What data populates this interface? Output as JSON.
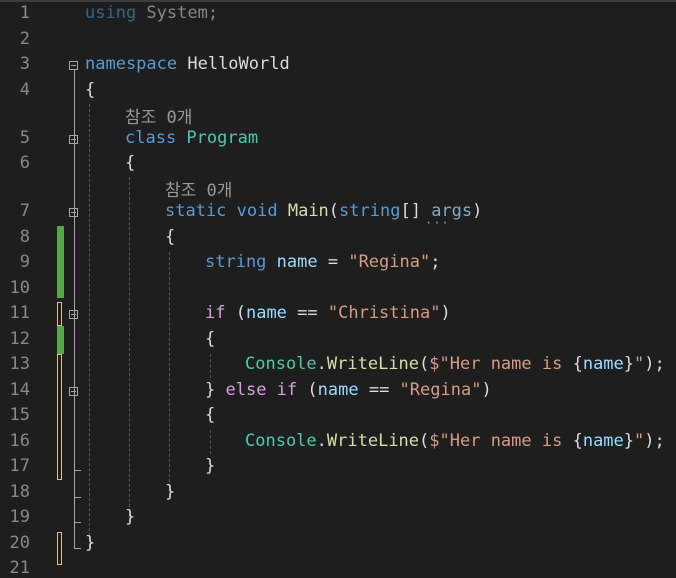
{
  "editor": {
    "line_numbers": [
      "1",
      "2",
      "3",
      "4",
      "5",
      "6",
      "7",
      "8",
      "9",
      "10",
      "11",
      "12",
      "13",
      "14",
      "15",
      "16",
      "17",
      "18",
      "19",
      "20",
      "21"
    ],
    "lines": {
      "l1_kw": "using",
      "l1_rest": " System;",
      "l3_kw": "namespace",
      "l3_name": " HelloWorld",
      "l4": "{",
      "lens_program": "참조 0개",
      "l5_kw": "class",
      "l5_name": " Program",
      "l6": "{",
      "lens_main": "참조 0개",
      "l7_kw1": "static",
      "l7_kw2": " void",
      "l7_fn": " Main",
      "l7_p1": "(",
      "l7_kw3": "string",
      "l7_p2": "[] ",
      "l7_param": "args",
      "l7_p3": ")",
      "l8": "{",
      "l9_kw": "string",
      "l9_var": " name",
      "l9_op": " = ",
      "l9_str": "\"Regina\"",
      "l9_end": ";",
      "l11_ctl": "if",
      "l11_p1": " (",
      "l11_var": "name",
      "l11_op": " == ",
      "l11_str": "\"Christina\"",
      "l11_p2": ")",
      "l12": "{",
      "l13_ty": "Console",
      "l13_dot": ".",
      "l13_fn": "WriteLine",
      "l13_p1": "(",
      "l13_str1": "$\"Her name is ",
      "l13_b1": "{",
      "l13_var": "name",
      "l13_b2": "}",
      "l13_str2": "\"",
      "l13_end": ");",
      "l14_b": "} ",
      "l14_ctl1": "else",
      "l14_ctl2": " if",
      "l14_p1": " (",
      "l14_var": "name",
      "l14_op": " == ",
      "l14_str": "\"Regina\"",
      "l14_p2": ")",
      "l15": "{",
      "l16_ty": "Console",
      "l16_dot": ".",
      "l16_fn": "WriteLine",
      "l16_p1": "(",
      "l16_str1": "$\"Her name is ",
      "l16_b1": "{",
      "l16_var": "name",
      "l16_b2": "}",
      "l16_str2": "\"",
      "l16_end": ");",
      "l17": "}",
      "l18": "}",
      "l19": "}",
      "l20": "}"
    }
  },
  "colors": {
    "background": "#1e1e1e",
    "keyword": "#569cd6",
    "type": "#4ec9b0",
    "method": "#dcdcaa",
    "string": "#d69d85",
    "variable": "#9cdcfe",
    "control": "#d8a0df",
    "change_saved": "#57a64a",
    "change_unsaved": "#e2c08d"
  }
}
